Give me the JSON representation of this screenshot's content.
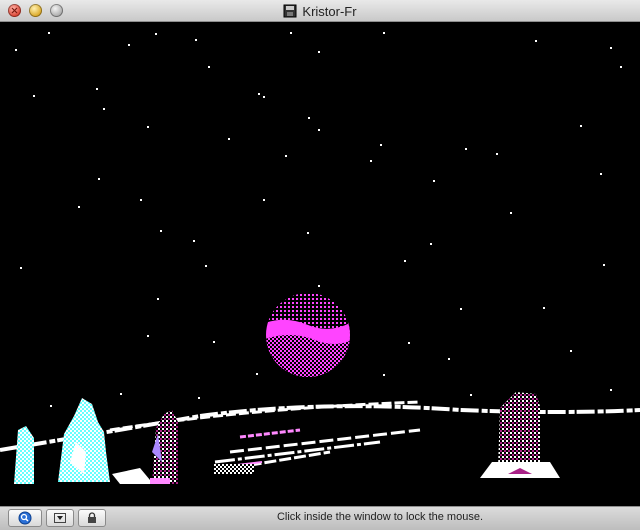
{
  "window": {
    "title": "Kristor-Fr"
  },
  "status": {
    "message": "Click inside the window to lock the mouse."
  },
  "toolbar": {
    "buttons": [
      {
        "name": "zoom-button",
        "icon": "magnifier-icon"
      },
      {
        "name": "menu-button",
        "icon": "dropdown-arrow-icon"
      },
      {
        "name": "lock-button",
        "icon": "padlock-icon"
      }
    ]
  },
  "scene": {
    "description_icon": "planet",
    "colors": {
      "sky": "#000000",
      "stars": "#ffffff",
      "planet": "#ff44ff",
      "planet_dark": "#7a1f7a",
      "ground": "#ffffff",
      "crystal": "#66ffff",
      "rock": "#aa2288"
    }
  }
}
